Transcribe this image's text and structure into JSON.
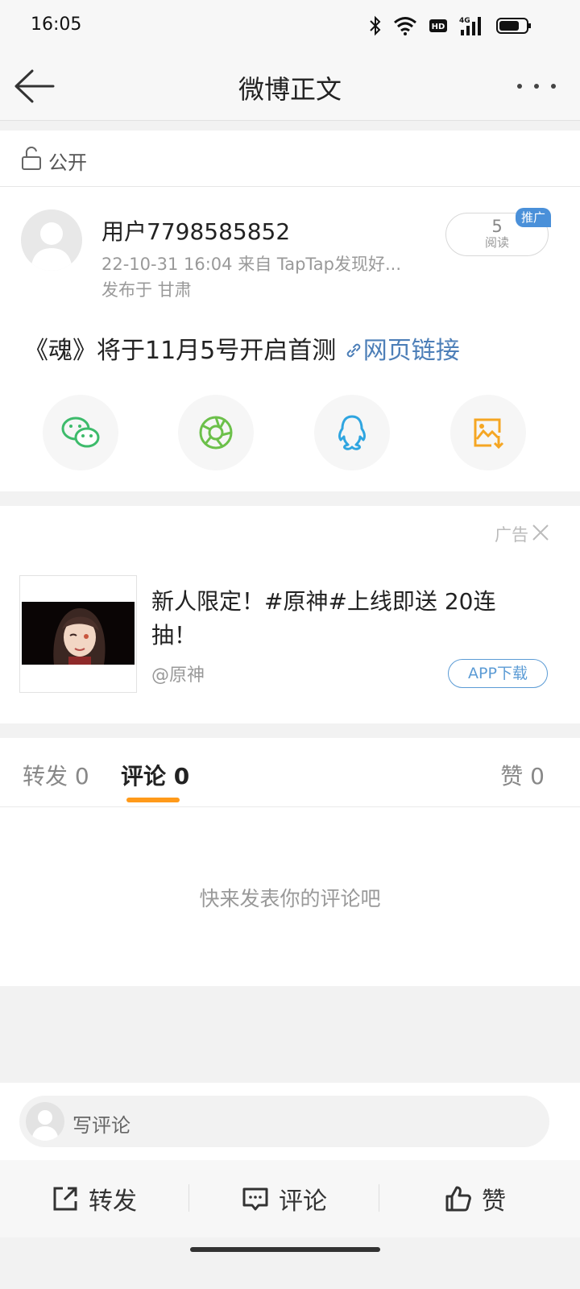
{
  "status_bar": {
    "time": "16:05",
    "battery_level": 0.75
  },
  "navbar": {
    "title": "微博正文"
  },
  "privacy": {
    "label": "公开"
  },
  "post": {
    "username": "用户7798585852",
    "meta_line1": "22-10-31 16:04  来自 TapTap发现好...",
    "location": "发布于 甘肃",
    "reads_count": "5",
    "reads_label": "阅读",
    "promo_tag": "推广",
    "text": "《魂》将于11月5号开启首测 ",
    "link_text": "网页链接"
  },
  "share": [
    {
      "icon": "wechat-icon",
      "color": "#3dbb6b"
    },
    {
      "icon": "moments-icon",
      "color": "#6cc04a"
    },
    {
      "icon": "qq-icon",
      "color": "#2fa5e0"
    },
    {
      "icon": "save-image-icon",
      "color": "#f5a623"
    }
  ],
  "ad": {
    "label": "广告",
    "title": "新人限定！#原神#上线即送 20连抽！",
    "account": "@原神",
    "button": "APP下载"
  },
  "tabs": {
    "repost": "转发 0",
    "comment": "评论 0",
    "like": "赞 0",
    "active_color": "#ff9a1a"
  },
  "comments": {
    "empty_text": "快来发表你的评论吧"
  },
  "composer": {
    "placeholder": "写评论"
  },
  "actions": {
    "repost": "转发",
    "comment": "评论",
    "like": "赞"
  }
}
